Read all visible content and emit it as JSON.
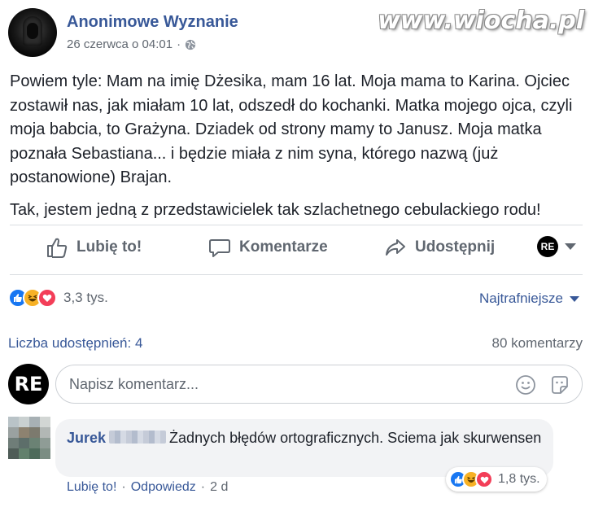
{
  "post": {
    "page_name": "Anonimowe Wyznanie",
    "date": "26 czerwca o 04:01",
    "separator": "·",
    "privacy_icon": "globe-icon",
    "paragraph1": "Powiem tyle: Mam na imię Dżesika, mam 16 lat. Moja mama to Karina. Ojciec zostawił nas, jak miałam 10 lat, odszedł do kochanki. Matka mojego ojca, czyli moja babcia, to Grażyna. Dziadek od strony mamy to Janusz. Moja matka poznała Sebastiana... i będzie miała z nim syna, którego nazwą (już postanowione) Brajan.",
    "paragraph2": "Tak, jestem jedną z przedstawicielek tak szlachetnego cebulackiego rodu!"
  },
  "watermark": "www.wiocha.pl",
  "actions": {
    "like": "Lubię to!",
    "comment": "Komentarze",
    "share": "Udostępnij",
    "profile_badge": "RE"
  },
  "stats": {
    "reaction_count": "3,3 tys.",
    "sort_label": "Najtrafniejsze",
    "shares": "Liczba udostępnień: 4",
    "comments": "80 komentarzy"
  },
  "composer": {
    "avatar_text": "RE",
    "placeholder": "Napisz komentarz..."
  },
  "comment": {
    "author": "Jurek",
    "text": "Żadnych błędów ortograficznych. Sciema jak skurwensen",
    "reaction_count": "1,8 tys.",
    "like": "Lubię to!",
    "reply": "Odpowiedz",
    "separator": "·",
    "age": "2 d"
  },
  "colors": {
    "link_blue": "#385898",
    "gray_text": "#606770",
    "like_blue": "#1877f2",
    "haha_yellow": "#f7b125",
    "love_red": "#f33e58"
  }
}
